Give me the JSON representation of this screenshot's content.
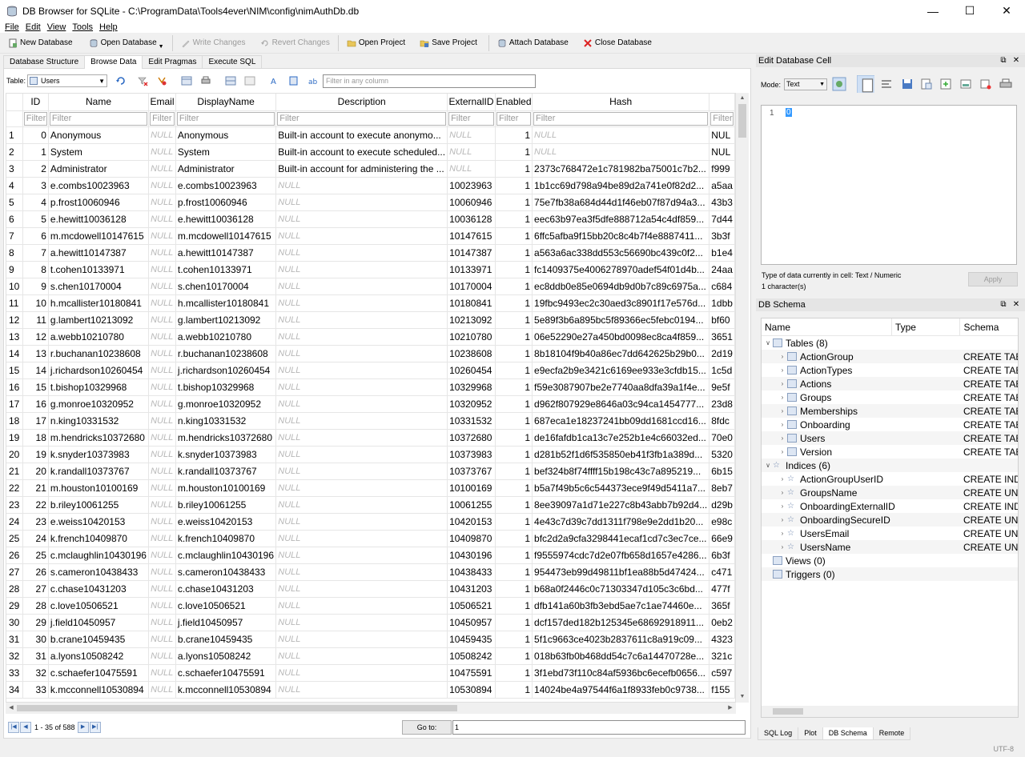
{
  "window": {
    "title": "DB Browser for SQLite - C:\\ProgramData\\Tools4ever\\NIM\\config\\nimAuthDb.db"
  },
  "menu": [
    {
      "label": "File"
    },
    {
      "label": "Edit"
    },
    {
      "label": "View"
    },
    {
      "label": "Tools"
    },
    {
      "label": "Help"
    }
  ],
  "toolbar": {
    "new_database": "New Database",
    "open_database": "Open Database",
    "write_changes": "Write Changes",
    "revert_changes": "Revert Changes",
    "open_project": "Open Project",
    "save_project": "Save Project",
    "attach_database": "Attach Database",
    "close_database": "Close Database"
  },
  "tabs": [
    {
      "label": "Database Structure"
    },
    {
      "label": "Browse Data",
      "active": true
    },
    {
      "label": "Edit Pragmas"
    },
    {
      "label": "Execute SQL"
    }
  ],
  "browse": {
    "table_label": "Table:",
    "table_value": "Users",
    "filter_placeholder": "Filter in any column"
  },
  "grid": {
    "columns": [
      "ID",
      "Name",
      "Email",
      "DisplayName",
      "Description",
      "ExternalID",
      "Enabled",
      "Hash",
      ""
    ],
    "filter_placeholder": "Filter",
    "null_text": "NULL",
    "rows": [
      [
        "1",
        "0",
        "Anonymous",
        null,
        "Anonymous",
        "Built-in account to execute anonymo...",
        null,
        "1",
        null,
        "NUL"
      ],
      [
        "2",
        "1",
        "System",
        null,
        "System",
        "Built-in account to execute scheduled...",
        null,
        "1",
        null,
        "NUL"
      ],
      [
        "3",
        "2",
        "Administrator",
        null,
        "Administrator",
        "Built-in account for administering the ...",
        null,
        "1",
        "2373c768472e1c781982ba75001c7b2...",
        "f999"
      ],
      [
        "4",
        "3",
        "e.combs10023963",
        null,
        "e.combs10023963",
        null,
        "10023963",
        "1",
        "1b1cc69d798a94be89d2a741e0f82d2...",
        "a5aa"
      ],
      [
        "5",
        "4",
        "p.frost10060946",
        null,
        "p.frost10060946",
        null,
        "10060946",
        "1",
        "75e7fb38a684d44d1f46eb07f87d94a3...",
        "43b3"
      ],
      [
        "6",
        "5",
        "e.hewitt10036128",
        null,
        "e.hewitt10036128",
        null,
        "10036128",
        "1",
        "eec63b97ea3f5dfe888712a54c4df859...",
        "7d44"
      ],
      [
        "7",
        "6",
        "m.mcdowell10147615",
        null,
        "m.mcdowell10147615",
        null,
        "10147615",
        "1",
        "6ffc5afba9f15bb20c8c4b7f4e8887411...",
        "3b3f"
      ],
      [
        "8",
        "7",
        "a.hewitt10147387",
        null,
        "a.hewitt10147387",
        null,
        "10147387",
        "1",
        "a563a6ac338dd553c56690bc439c0f2...",
        "b1e4"
      ],
      [
        "9",
        "8",
        "t.cohen10133971",
        null,
        "t.cohen10133971",
        null,
        "10133971",
        "1",
        "fc1409375e4006278970adef54f01d4b...",
        "24aa"
      ],
      [
        "10",
        "9",
        "s.chen10170004",
        null,
        "s.chen10170004",
        null,
        "10170004",
        "1",
        "ec8ddb0e85e0694db9d0b7c89c6975a...",
        "c684"
      ],
      [
        "11",
        "10",
        "h.mcallister10180841",
        null,
        "h.mcallister10180841",
        null,
        "10180841",
        "1",
        "19fbc9493ec2c30aed3c8901f17e576d...",
        "1dbb"
      ],
      [
        "12",
        "11",
        "g.lambert10213092",
        null,
        "g.lambert10213092",
        null,
        "10213092",
        "1",
        "5e89f3b6a895bc5f89366ec5febc0194...",
        "bf60"
      ],
      [
        "13",
        "12",
        "a.webb10210780",
        null,
        "a.webb10210780",
        null,
        "10210780",
        "1",
        "06e52290e27a450bd0098ec8ca4f859...",
        "3651"
      ],
      [
        "14",
        "13",
        "r.buchanan10238608",
        null,
        "r.buchanan10238608",
        null,
        "10238608",
        "1",
        "8b18104f9b40a86ec7dd642625b29b0...",
        "2d19"
      ],
      [
        "15",
        "14",
        "j.richardson10260454",
        null,
        "j.richardson10260454",
        null,
        "10260454",
        "1",
        "e9ecfa2b9e3421c6169ee933e3cfdb15...",
        "1c5d"
      ],
      [
        "16",
        "15",
        "t.bishop10329968",
        null,
        "t.bishop10329968",
        null,
        "10329968",
        "1",
        "f59e3087907be2e7740aa8dfa39a1f4e...",
        "9e5f"
      ],
      [
        "17",
        "16",
        "g.monroe10320952",
        null,
        "g.monroe10320952",
        null,
        "10320952",
        "1",
        "d962f807929e8646a03c94ca1454777...",
        "23d8"
      ],
      [
        "18",
        "17",
        "n.king10331532",
        null,
        "n.king10331532",
        null,
        "10331532",
        "1",
        "687eca1e18237241bb09dd1681ccd16...",
        "8fdc"
      ],
      [
        "19",
        "18",
        "m.hendricks10372680",
        null,
        "m.hendricks10372680",
        null,
        "10372680",
        "1",
        "de16fafdb1ca13c7e252b1e4c66032ed...",
        "70e0"
      ],
      [
        "20",
        "19",
        "k.snyder10373983",
        null,
        "k.snyder10373983",
        null,
        "10373983",
        "1",
        "d281b52f1d6f535850eb41f3fb1a389d...",
        "5320"
      ],
      [
        "21",
        "20",
        "k.randall10373767",
        null,
        "k.randall10373767",
        null,
        "10373767",
        "1",
        "bef324b8f74ffff15b198c43c7a895219...",
        "6b15"
      ],
      [
        "22",
        "21",
        "m.houston10100169",
        null,
        "m.houston10100169",
        null,
        "10100169",
        "1",
        "b5a7f49b5c6c544373ece9f49d5411a7...",
        "8eb7"
      ],
      [
        "23",
        "22",
        "b.riley10061255",
        null,
        "b.riley10061255",
        null,
        "10061255",
        "1",
        "8ee39097a1d71e227c8b43abb7b92d4...",
        "d29b"
      ],
      [
        "24",
        "23",
        "e.weiss10420153",
        null,
        "e.weiss10420153",
        null,
        "10420153",
        "1",
        "4e43c7d39c7dd1311f798e9e2dd1b20...",
        "e98c"
      ],
      [
        "25",
        "24",
        "k.french10409870",
        null,
        "k.french10409870",
        null,
        "10409870",
        "1",
        "bfc2d2a9cfa3298441ecaf1cd7c3ec7ce...",
        "66e9"
      ],
      [
        "26",
        "25",
        "c.mclaughlin10430196",
        null,
        "c.mclaughlin10430196",
        null,
        "10430196",
        "1",
        "f9555974cdc7d2e07fb658d1657e4286...",
        "6b3f"
      ],
      [
        "27",
        "26",
        "s.cameron10438433",
        null,
        "s.cameron10438433",
        null,
        "10438433",
        "1",
        "954473eb99d49811bf1ea88b5d47424...",
        "c471"
      ],
      [
        "28",
        "27",
        "c.chase10431203",
        null,
        "c.chase10431203",
        null,
        "10431203",
        "1",
        "b68a0f2446c0c71303347d105c3c6bd...",
        "477f"
      ],
      [
        "29",
        "28",
        "c.love10506521",
        null,
        "c.love10506521",
        null,
        "10506521",
        "1",
        "dfb141a60b3fb3ebd5ae7c1ae74460e...",
        "365f"
      ],
      [
        "30",
        "29",
        "j.field10450957",
        null,
        "j.field10450957",
        null,
        "10450957",
        "1",
        "dcf157ded182b125345e68692918911...",
        "0eb2"
      ],
      [
        "31",
        "30",
        "b.crane10459435",
        null,
        "b.crane10459435",
        null,
        "10459435",
        "1",
        "5f1c9663ce4023b2837611c8a919c09...",
        "4323"
      ],
      [
        "32",
        "31",
        "a.lyons10508242",
        null,
        "a.lyons10508242",
        null,
        "10508242",
        "1",
        "018b63fb0b468dd54c7c6a14470728e...",
        "321c"
      ],
      [
        "33",
        "32",
        "c.schaefer10475591",
        null,
        "c.schaefer10475591",
        null,
        "10475591",
        "1",
        "3f1ebd73f110c84af5936bc6ecefb0656...",
        "c597"
      ],
      [
        "34",
        "33",
        "k.mcconnell10530894",
        null,
        "k.mcconnell10530894",
        null,
        "10530894",
        "1",
        "14024be4a97544f6a1f8933feb0c9738...",
        "f155"
      ]
    ]
  },
  "navigation": {
    "range_text": "1 - 35 of 588",
    "goto_label": "Go to:",
    "goto_value": "1"
  },
  "edit_cell": {
    "title": "Edit Database Cell",
    "mode_label": "Mode:",
    "mode_value": "Text",
    "line_number": "1",
    "cell_value": "0",
    "type_info": "Type of data currently in cell: Text / Numeric",
    "size_info": "1 character(s)",
    "apply_label": "Apply"
  },
  "schema": {
    "title": "DB Schema",
    "columns": [
      "Name",
      "Type",
      "Schema"
    ],
    "tables_label": "Tables (8)",
    "tables": [
      {
        "name": "ActionGroup",
        "schema": "CREATE TAB"
      },
      {
        "name": "ActionTypes",
        "schema": "CREATE TAB"
      },
      {
        "name": "Actions",
        "schema": "CREATE TAB"
      },
      {
        "name": "Groups",
        "schema": "CREATE TAB"
      },
      {
        "name": "Memberships",
        "schema": "CREATE TAB"
      },
      {
        "name": "Onboarding",
        "schema": "CREATE TAB"
      },
      {
        "name": "Users",
        "schema": "CREATE TAB"
      },
      {
        "name": "Version",
        "schema": "CREATE TAB"
      }
    ],
    "indices_label": "Indices (6)",
    "indices": [
      {
        "name": "ActionGroupUserID",
        "schema": "CREATE INDI"
      },
      {
        "name": "GroupsName",
        "schema": "CREATE UNIQ"
      },
      {
        "name": "OnboardingExternalID",
        "schema": "CREATE INDI"
      },
      {
        "name": "OnboardingSecureID",
        "schema": "CREATE UNIQ"
      },
      {
        "name": "UsersEmail",
        "schema": "CREATE UNIQ"
      },
      {
        "name": "UsersName",
        "schema": "CREATE UNIQ"
      }
    ],
    "views_label": "Views (0)",
    "triggers_label": "Triggers (0)"
  },
  "bottom_tabs": [
    {
      "label": "SQL Log"
    },
    {
      "label": "Plot"
    },
    {
      "label": "DB Schema",
      "active": true
    },
    {
      "label": "Remote"
    }
  ],
  "status": {
    "encoding": "UTF-8"
  }
}
